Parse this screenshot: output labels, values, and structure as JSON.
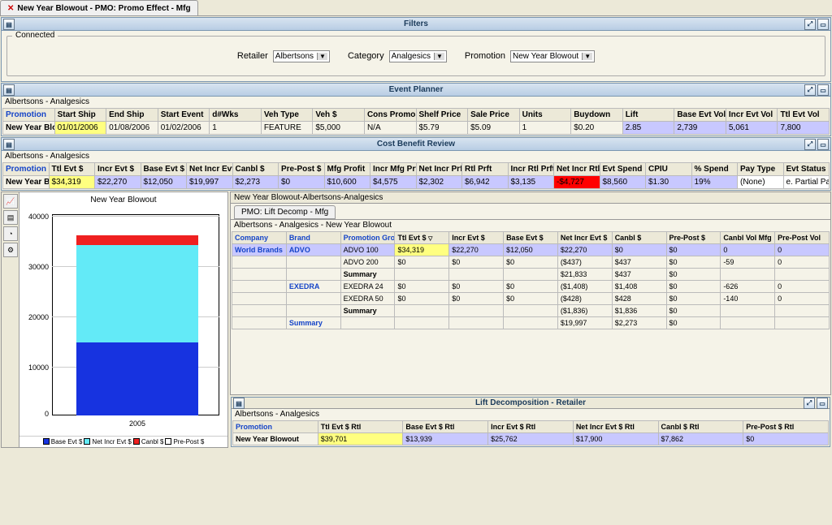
{
  "tab": {
    "title": "New Year Blowout - PMO: Promo Effect - Mfg"
  },
  "filters": {
    "title": "Filters",
    "connected": "Connected",
    "retailer_label": "Retailer",
    "retailer_value": "Albertsons",
    "category_label": "Category",
    "category_value": "Analgesics",
    "promotion_label": "Promotion",
    "promotion_value": "New Year Blowout"
  },
  "event_planner": {
    "title": "Event Planner",
    "section": "Albertsons - Analgesics",
    "headers": [
      "Promotion",
      "Start Ship",
      "End Ship",
      "Start Event",
      "d#Wks",
      "Veh Type",
      "Veh $",
      "Cons Promo",
      "Shelf Price",
      "Sale Price",
      "Units",
      "Buydown",
      "Lift",
      "Base Evt Vol",
      "Incr Evt Vol",
      "Ttl Evt Vol"
    ],
    "row": [
      "New Year Blowout",
      "01/01/2006",
      "01/08/2006",
      "01/02/2006",
      "1",
      "FEATURE",
      "$5,000",
      "N/A",
      "$5.79",
      "$5.09",
      "1",
      "$0.20",
      "2.85",
      "2,739",
      "5,061",
      "7,800"
    ]
  },
  "cost_benefit": {
    "title": "Cost Benefit Review",
    "section": "Albertsons - Analgesics",
    "headers": [
      "Promotion",
      "Ttl Evt $",
      "Incr Evt $",
      "Base Evt $",
      "Net Incr Evt $",
      "Canbl $",
      "Pre-Post $",
      "Mfg Profit",
      "Incr Mfg Prft",
      "Net Incr Prft",
      "Rtl Prft",
      "Incr Rtl Prft",
      "Net Incr Rtl Prft",
      "Evt Spend",
      "CPIU",
      "% Spend",
      "Pay Type",
      "Evt Status"
    ],
    "row": [
      "New Year Blowout",
      "$34,319",
      "$22,270",
      "$12,050",
      "$19,997",
      "$2,273",
      "$0",
      "$10,600",
      "$4,575",
      "$2,302",
      "$6,942",
      "$3,135",
      "-$4,727",
      "$8,560",
      "$1.30",
      "19%",
      "(None)",
      "e. Partial Paid"
    ]
  },
  "chart_data": {
    "type": "bar-stacked",
    "title": "New Year Blowout",
    "categories": [
      "2005"
    ],
    "ylim": [
      0,
      40000
    ],
    "yticks": [
      0,
      10000,
      20000,
      30000,
      40000
    ],
    "series": [
      {
        "name": "Base Evt $",
        "color": "#1733e0",
        "values": [
          12050
        ]
      },
      {
        "name": "Net Incr Evt $",
        "color": "#63eaf7",
        "values": [
          19997
        ]
      },
      {
        "name": "Canbl $",
        "color": "#ef2020",
        "values": [
          2273
        ]
      },
      {
        "name": "Pre-Post $",
        "color": "#ffffff",
        "values": [
          0
        ]
      }
    ]
  },
  "decomp": {
    "header": "New Year Blowout-Albertsons-Analgesics",
    "tab": "PMO: Lift Decomp - Mfg",
    "section": "Albertsons - Analgesics - New Year Blowout",
    "headers": [
      "Company",
      "Brand",
      "Promotion Group",
      "Ttl Evt $",
      "Incr Evt $",
      "Base Evt $",
      "Net Incr Evt $",
      "Canbl $",
      "Pre-Post $",
      "Canbl Vol Mfg",
      "Pre-Post Vol"
    ],
    "rows": [
      {
        "company": "World Brands",
        "brand": "ADVO",
        "pg": "ADVO 100",
        "vals": [
          "$34,319",
          "$22,270",
          "$12,050",
          "$22,270",
          "$0",
          "$0",
          "0",
          "0"
        ],
        "hi": true
      },
      {
        "company": "",
        "brand": "",
        "pg": "ADVO 200",
        "vals": [
          "$0",
          "$0",
          "$0",
          "($437)",
          "$437",
          "$0",
          "-59",
          "0"
        ]
      },
      {
        "company": "",
        "brand": "",
        "pg": "Summary",
        "vals": [
          "",
          "",
          "",
          "$21,833",
          "$437",
          "$0",
          "",
          ""
        ]
      },
      {
        "company": "",
        "brand": "EXEDRA",
        "pg": "EXEDRA 24",
        "vals": [
          "$0",
          "$0",
          "$0",
          "($1,408)",
          "$1,408",
          "$0",
          "-626",
          "0"
        ]
      },
      {
        "company": "",
        "brand": "",
        "pg": "EXEDRA 50",
        "vals": [
          "$0",
          "$0",
          "$0",
          "($428)",
          "$428",
          "$0",
          "-140",
          "0"
        ]
      },
      {
        "company": "",
        "brand": "",
        "pg": "Summary",
        "vals": [
          "",
          "",
          "",
          "($1,836)",
          "$1,836",
          "$0",
          "",
          ""
        ]
      },
      {
        "company": "",
        "brand": "Summary",
        "pg": "",
        "vals": [
          "",
          "",
          "",
          "$19,997",
          "$2,273",
          "$0",
          "",
          ""
        ]
      }
    ]
  },
  "retailer_decomp": {
    "title": "Lift Decomposition - Retailer",
    "section": "Albertsons - Analgesics",
    "headers": [
      "Promotion",
      "Ttl Evt $ Rtl",
      "Base Evt $ Rtl",
      "Incr Evt $ Rtl",
      "Net Incr Evt $ Rtl",
      "Canbl $ Rtl",
      "Pre-Post $ Rtl"
    ],
    "row": [
      "New Year Blowout",
      "$39,701",
      "$13,939",
      "$25,762",
      "$17,900",
      "$7,862",
      "$0"
    ]
  }
}
